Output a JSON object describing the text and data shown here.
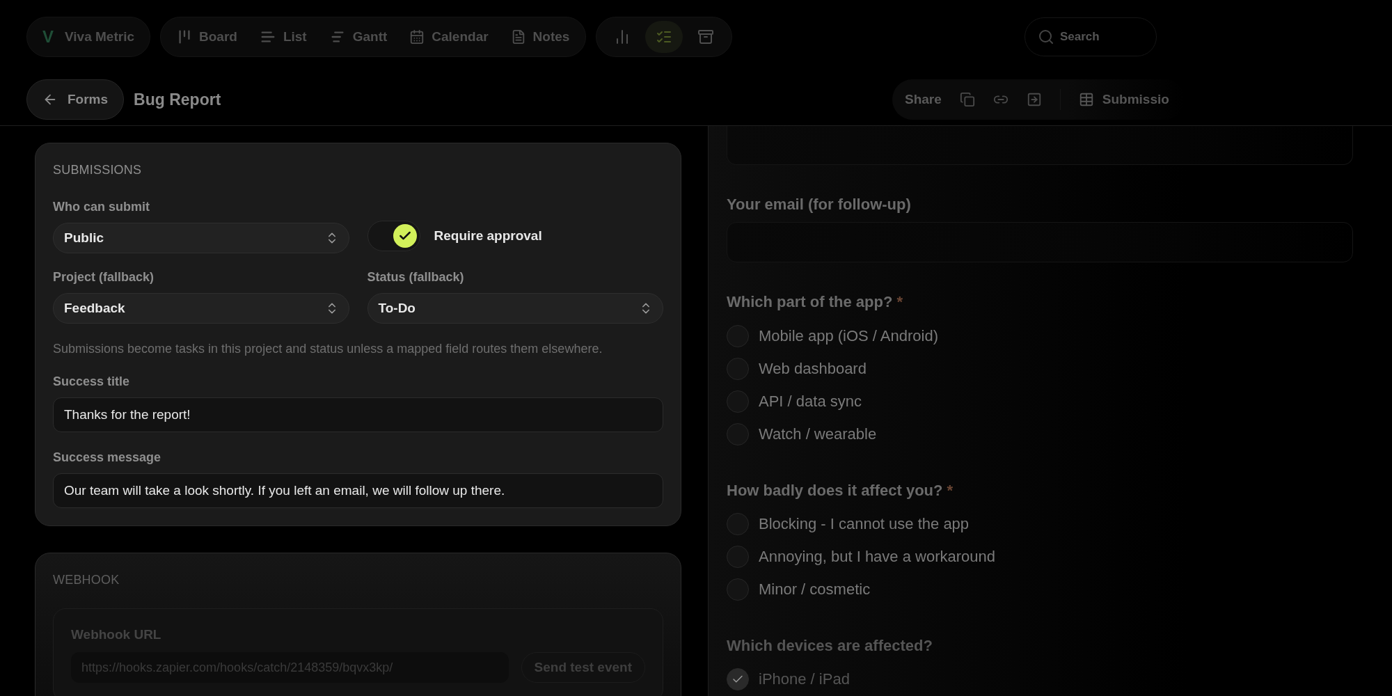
{
  "app": {
    "logo": "V",
    "name": "Viva Metric"
  },
  "views": [
    {
      "label": "Board",
      "selected": false
    },
    {
      "label": "List",
      "selected": false
    },
    {
      "label": "Gantt",
      "selected": false
    },
    {
      "label": "Calendar",
      "selected": false
    },
    {
      "label": "Notes",
      "selected": false
    }
  ],
  "tools": [
    {
      "selected": false
    },
    {
      "selected": true
    },
    {
      "selected": false
    }
  ],
  "search": {
    "placeholder": "Search"
  },
  "header": {
    "back": "Forms",
    "title": "Bug Report",
    "share": "Share",
    "submissions": "Submissio"
  },
  "submissions_card": {
    "title": "SUBMISSIONS",
    "who_label": "Who can submit",
    "who_value": "Public",
    "approval": {
      "label": "Require approval",
      "on": true
    },
    "project_label": "Project (fallback)",
    "project_value": "Feedback",
    "status_label": "Status (fallback)",
    "status_value": "To-Do",
    "hint": "Submissions become tasks in this project and status unless a mapped field routes them elsewhere.",
    "success_title_label": "Success title",
    "success_title_value": "Thanks for the report!",
    "success_message_label": "Success message",
    "success_message_value": "Our team will take a look shortly. If you left an email, we will follow up there."
  },
  "webhook_card": {
    "title": "WEBHOOK",
    "url_label": "Webhook URL",
    "url_value": "https://hooks.zapier.com/hooks/catch/2148359/bqvx3kp/",
    "test_button": "Send test event"
  },
  "preview": [
    {
      "kind": "input"
    },
    {
      "kind": "input",
      "label": "Your email (for follow-up)"
    },
    {
      "kind": "radio",
      "label": "Which part of the app?",
      "required_mark": "*",
      "options": [
        {
          "label": "Mobile app (iOS / Android)",
          "selected": false
        },
        {
          "label": "Web dashboard",
          "selected": false
        },
        {
          "label": "API / data sync",
          "selected": false
        },
        {
          "label": "Watch / wearable",
          "selected": false
        }
      ]
    },
    {
      "kind": "radio",
      "label": "How badly does it affect you?",
      "required_mark": "*",
      "options": [
        {
          "label": "Blocking - I cannot use the app",
          "selected": false
        },
        {
          "label": "Annoying, but I have a workaround",
          "selected": false
        },
        {
          "label": "Minor / cosmetic",
          "selected": false
        }
      ]
    },
    {
      "kind": "checkbox",
      "label": "Which devices are affected?",
      "options": [
        {
          "label": "iPhone / iPad",
          "checked": true
        }
      ]
    }
  ]
}
